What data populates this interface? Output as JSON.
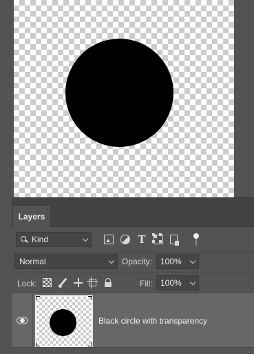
{
  "canvas": {
    "background": "transparent-checkerboard",
    "shape": "black-circle",
    "shape_color": "#000000"
  },
  "layers_panel": {
    "tab_label": "Layers",
    "filter": {
      "kind_label": "Kind",
      "icons": [
        "image-filter-icon",
        "adjustment-filter-icon",
        "type-filter-icon",
        "shape-filter-icon",
        "smart-object-filter-icon",
        "filter-toggle"
      ]
    },
    "blend_mode": "Normal",
    "opacity_label": "Opacity:",
    "opacity_value": "100%",
    "lock_label": "Lock:",
    "lock_icons": [
      "lock-transparent-pixels-icon",
      "lock-image-pixels-icon",
      "lock-position-icon",
      "lock-artboard-icon",
      "lock-all-icon"
    ],
    "fill_label": "Fill:",
    "fill_value": "100%",
    "layers": [
      {
        "name": "Black circle with transparency",
        "visible": true,
        "selected": true
      }
    ]
  },
  "colors": {
    "app_bg": "#535353",
    "panel_header": "#424242",
    "selected_row": "#676767"
  }
}
